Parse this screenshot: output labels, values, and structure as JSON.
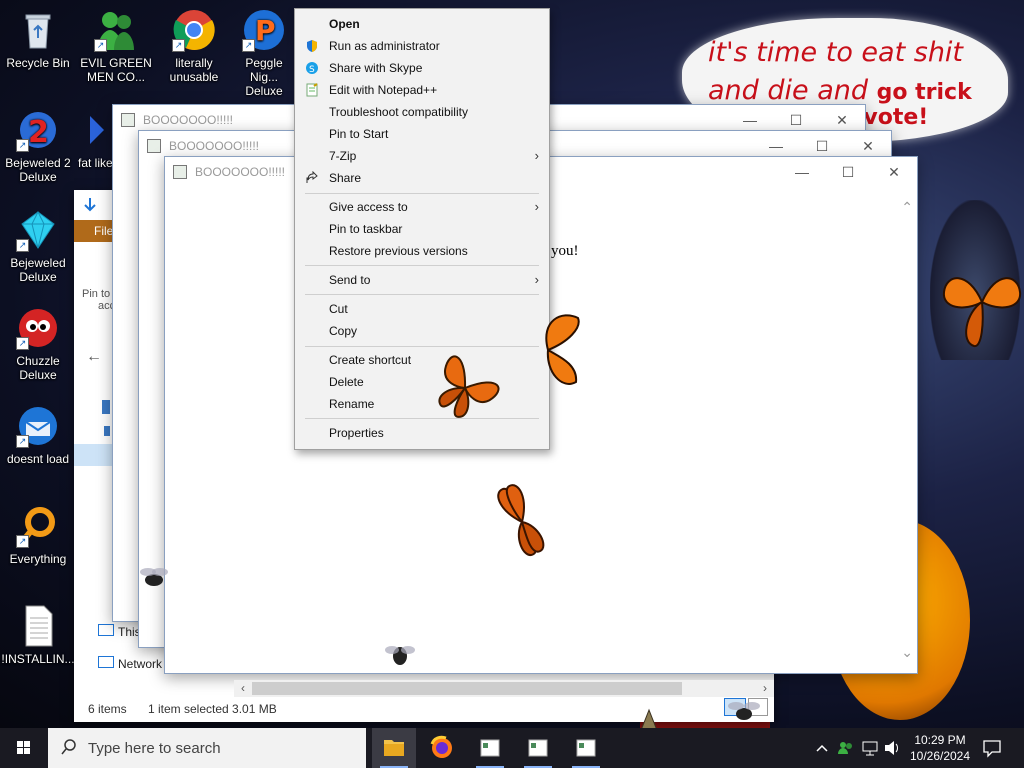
{
  "wallpaper": {
    "meme_lines": [
      "it's time to eat shit",
      "and die and",
      "go trick",
      "d vote!"
    ]
  },
  "desktop_icons": [
    {
      "label": "Recycle Bin"
    },
    {
      "label": "EVIL GREEN MEN CO..."
    },
    {
      "label": "literally unusable"
    },
    {
      "label": "Peggle Nig... Deluxe"
    },
    {
      "label": "Bejeweled 2 Deluxe"
    },
    {
      "label": "fat like"
    },
    {
      "label": "Bejeweled Deluxe"
    },
    {
      "label": "Chuzzle Deluxe"
    },
    {
      "label": "doesnt load"
    },
    {
      "label": "Everything"
    },
    {
      "label": "!INSTALLIN..."
    }
  ],
  "explorer": {
    "file_tab": "File",
    "pin_label": "Pin to",
    "pin_label2": "acc",
    "nav_this_pc": "This",
    "nav_network": "Network",
    "status_items": "6 items",
    "status_selected": "1 item selected  3.01 MB"
  },
  "boo_windows": [
    {
      "title": "BOOOOOOO!!!!!"
    },
    {
      "title": "BOOOOOOO!!!!!"
    },
    {
      "title": "BOOOOOOO!!!!!"
    }
  ],
  "boo_body_text": "you!",
  "window_controls": {
    "minimize": "—",
    "maximize": "☐",
    "close": "✕"
  },
  "context_menu": {
    "items": [
      {
        "label": "Open",
        "bold": true,
        "icon": ""
      },
      {
        "label": "Run as administrator",
        "icon": "shield-icon"
      },
      {
        "label": "Share with Skype",
        "icon": "skype-icon"
      },
      {
        "label": "Edit with Notepad++",
        "icon": "notepadpp-icon"
      },
      {
        "label": "Troubleshoot compatibility",
        "icon": ""
      },
      {
        "label": "Pin to Start",
        "icon": ""
      },
      {
        "label": "7-Zip",
        "icon": "",
        "submenu": true
      },
      {
        "label": "Share",
        "icon": "share-icon"
      },
      {
        "label": "Give access to",
        "icon": "",
        "submenu": true
      },
      {
        "label": "Pin to taskbar",
        "icon": ""
      },
      {
        "label": "Restore previous versions",
        "icon": ""
      },
      {
        "label": "Send to",
        "icon": "",
        "submenu": true
      },
      {
        "label": "Cut",
        "icon": ""
      },
      {
        "label": "Copy",
        "icon": ""
      },
      {
        "label": "Create shortcut",
        "icon": ""
      },
      {
        "label": "Delete",
        "icon": ""
      },
      {
        "label": "Rename",
        "icon": ""
      },
      {
        "label": "Properties",
        "icon": ""
      }
    ],
    "submenu_arrow": "›"
  },
  "taskbar": {
    "search_placeholder": "Type here to search",
    "time": "10:29 PM",
    "date": "10/26/2024"
  },
  "colors": {
    "meme_text": "#c8101a",
    "taskbar_bg": "#1a1a22",
    "explorer_ribbon": "#ecb86a",
    "butterfly_orange": "#f07a10"
  }
}
